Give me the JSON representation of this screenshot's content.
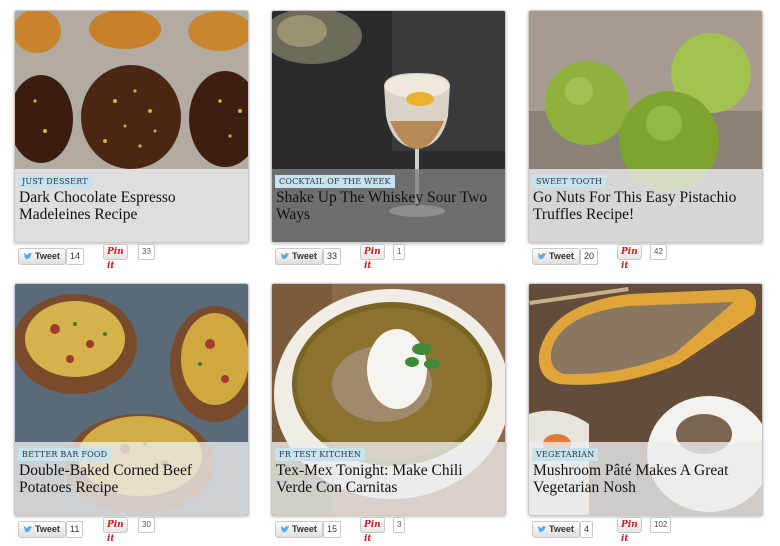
{
  "cards": [
    {
      "category": "JUST DESSERT",
      "title": "Dark Chocolate Espresso Madeleines Recipe",
      "tweet": "Tweet",
      "tweet_count": "14",
      "pin": "Pin it",
      "pin_count": "33"
    },
    {
      "category": "COCKTAIL OF THE WEEK",
      "title": "Shake Up The Whiskey Sour Two Ways",
      "tweet": "Tweet",
      "tweet_count": "33",
      "pin": "Pin it",
      "pin_count": "1"
    },
    {
      "category": "SWEET TOOTH",
      "title": "Go Nuts For This Easy Pistachio Truffles Recipe!",
      "tweet": "Tweet",
      "tweet_count": "20",
      "pin": "Pin it",
      "pin_count": "42"
    },
    {
      "category": "BETTER BAR FOOD",
      "title": "Double-Baked Corned Beef Potatoes Recipe",
      "tweet": "Tweet",
      "tweet_count": "11",
      "pin": "Pin it",
      "pin_count": "30"
    },
    {
      "category": "FR TEST KITCHEN",
      "title": "Tex-Mex Tonight: Make Chili Verde Con Carnitas",
      "tweet": "Tweet",
      "tweet_count": "15",
      "pin": "Pin it",
      "pin_count": "3"
    },
    {
      "category": "VEGETARIAN",
      "title": "Mushroom Pâté Makes A Great Vegetarian Nosh",
      "tweet": "Tweet",
      "tweet_count": "4",
      "pin": "Pin it",
      "pin_count": "102"
    }
  ],
  "colors": {
    "badge_bg": "#c6e4ef",
    "pin_red": "#cb2027",
    "twitter_blue": "#55acee"
  },
  "icons": [
    "twitter-bird-icon"
  ]
}
